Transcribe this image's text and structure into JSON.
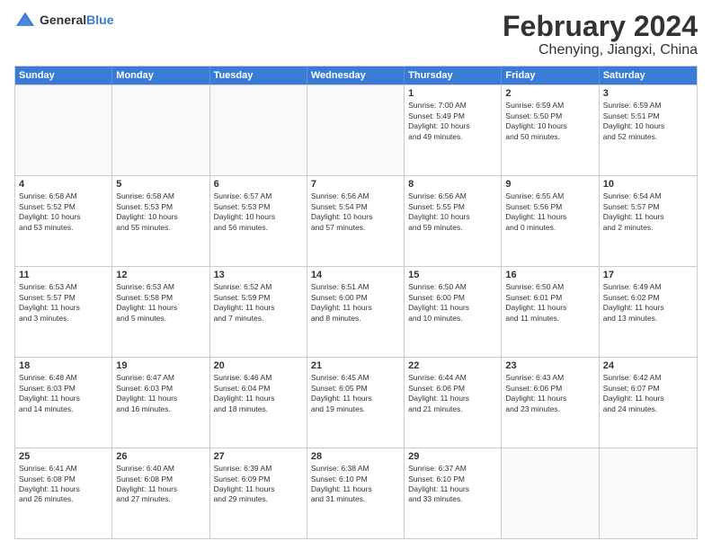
{
  "logo": {
    "line1": "General",
    "line2": "Blue"
  },
  "title": "February 2024",
  "subtitle": "Chenying, Jiangxi, China",
  "header_days": [
    "Sunday",
    "Monday",
    "Tuesday",
    "Wednesday",
    "Thursday",
    "Friday",
    "Saturday"
  ],
  "rows": [
    [
      {
        "day": "",
        "info": "",
        "empty": true
      },
      {
        "day": "",
        "info": "",
        "empty": true
      },
      {
        "day": "",
        "info": "",
        "empty": true
      },
      {
        "day": "",
        "info": "",
        "empty": true
      },
      {
        "day": "1",
        "info": "Sunrise: 7:00 AM\nSunset: 5:49 PM\nDaylight: 10 hours\nand 49 minutes."
      },
      {
        "day": "2",
        "info": "Sunrise: 6:59 AM\nSunset: 5:50 PM\nDaylight: 10 hours\nand 50 minutes."
      },
      {
        "day": "3",
        "info": "Sunrise: 6:59 AM\nSunset: 5:51 PM\nDaylight: 10 hours\nand 52 minutes."
      }
    ],
    [
      {
        "day": "4",
        "info": "Sunrise: 6:58 AM\nSunset: 5:52 PM\nDaylight: 10 hours\nand 53 minutes."
      },
      {
        "day": "5",
        "info": "Sunrise: 6:58 AM\nSunset: 5:53 PM\nDaylight: 10 hours\nand 55 minutes."
      },
      {
        "day": "6",
        "info": "Sunrise: 6:57 AM\nSunset: 5:53 PM\nDaylight: 10 hours\nand 56 minutes."
      },
      {
        "day": "7",
        "info": "Sunrise: 6:56 AM\nSunset: 5:54 PM\nDaylight: 10 hours\nand 57 minutes."
      },
      {
        "day": "8",
        "info": "Sunrise: 6:56 AM\nSunset: 5:55 PM\nDaylight: 10 hours\nand 59 minutes."
      },
      {
        "day": "9",
        "info": "Sunrise: 6:55 AM\nSunset: 5:56 PM\nDaylight: 11 hours\nand 0 minutes."
      },
      {
        "day": "10",
        "info": "Sunrise: 6:54 AM\nSunset: 5:57 PM\nDaylight: 11 hours\nand 2 minutes."
      }
    ],
    [
      {
        "day": "11",
        "info": "Sunrise: 6:53 AM\nSunset: 5:57 PM\nDaylight: 11 hours\nand 3 minutes."
      },
      {
        "day": "12",
        "info": "Sunrise: 6:53 AM\nSunset: 5:58 PM\nDaylight: 11 hours\nand 5 minutes."
      },
      {
        "day": "13",
        "info": "Sunrise: 6:52 AM\nSunset: 5:59 PM\nDaylight: 11 hours\nand 7 minutes."
      },
      {
        "day": "14",
        "info": "Sunrise: 6:51 AM\nSunset: 6:00 PM\nDaylight: 11 hours\nand 8 minutes."
      },
      {
        "day": "15",
        "info": "Sunrise: 6:50 AM\nSunset: 6:00 PM\nDaylight: 11 hours\nand 10 minutes."
      },
      {
        "day": "16",
        "info": "Sunrise: 6:50 AM\nSunset: 6:01 PM\nDaylight: 11 hours\nand 11 minutes."
      },
      {
        "day": "17",
        "info": "Sunrise: 6:49 AM\nSunset: 6:02 PM\nDaylight: 11 hours\nand 13 minutes."
      }
    ],
    [
      {
        "day": "18",
        "info": "Sunrise: 6:48 AM\nSunset: 6:03 PM\nDaylight: 11 hours\nand 14 minutes."
      },
      {
        "day": "19",
        "info": "Sunrise: 6:47 AM\nSunset: 6:03 PM\nDaylight: 11 hours\nand 16 minutes."
      },
      {
        "day": "20",
        "info": "Sunrise: 6:46 AM\nSunset: 6:04 PM\nDaylight: 11 hours\nand 18 minutes."
      },
      {
        "day": "21",
        "info": "Sunrise: 6:45 AM\nSunset: 6:05 PM\nDaylight: 11 hours\nand 19 minutes."
      },
      {
        "day": "22",
        "info": "Sunrise: 6:44 AM\nSunset: 6:06 PM\nDaylight: 11 hours\nand 21 minutes."
      },
      {
        "day": "23",
        "info": "Sunrise: 6:43 AM\nSunset: 6:06 PM\nDaylight: 11 hours\nand 23 minutes."
      },
      {
        "day": "24",
        "info": "Sunrise: 6:42 AM\nSunset: 6:07 PM\nDaylight: 11 hours\nand 24 minutes."
      }
    ],
    [
      {
        "day": "25",
        "info": "Sunrise: 6:41 AM\nSunset: 6:08 PM\nDaylight: 11 hours\nand 26 minutes."
      },
      {
        "day": "26",
        "info": "Sunrise: 6:40 AM\nSunset: 6:08 PM\nDaylight: 11 hours\nand 27 minutes."
      },
      {
        "day": "27",
        "info": "Sunrise: 6:39 AM\nSunset: 6:09 PM\nDaylight: 11 hours\nand 29 minutes."
      },
      {
        "day": "28",
        "info": "Sunrise: 6:38 AM\nSunset: 6:10 PM\nDaylight: 11 hours\nand 31 minutes."
      },
      {
        "day": "29",
        "info": "Sunrise: 6:37 AM\nSunset: 6:10 PM\nDaylight: 11 hours\nand 33 minutes."
      },
      {
        "day": "",
        "info": "",
        "empty": true
      },
      {
        "day": "",
        "info": "",
        "empty": true
      }
    ]
  ]
}
